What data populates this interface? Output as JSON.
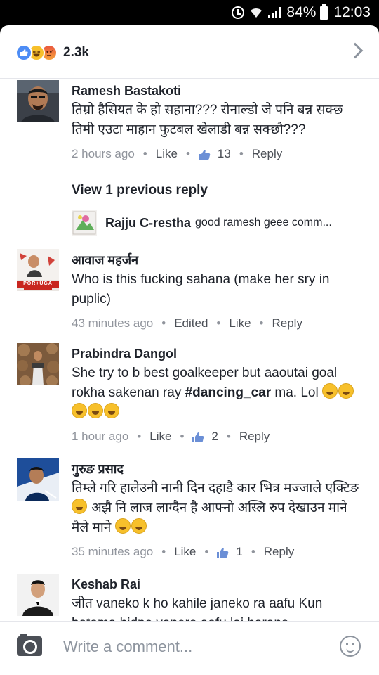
{
  "status_bar": {
    "battery": "84%",
    "time": "12:03"
  },
  "reactions": {
    "icons": [
      "like-icon",
      "haha-icon",
      "angry-icon"
    ],
    "count": "2.3k"
  },
  "comments": [
    {
      "author": "Ramesh Bastakoti",
      "text": "तिम्रो हैसियत के हो सहाना??? रोनाल्डो जे पनि बन्न सक्छ तिमी एउटा माहान फुटबल खेलाडी बन्न सक्छौ???",
      "time": "2 hours ago",
      "like": "Like",
      "likes": "13",
      "reply": "Reply",
      "view_replies": "View 1 previous reply",
      "reply_preview": {
        "author": "Rajju C-restha",
        "text": "good ramesh geee comm..."
      }
    },
    {
      "author": "आवाज महर्जन",
      "text": "Who is this fucking sahana (make her sry in puplic)",
      "time": "43 minutes ago",
      "edited": "Edited",
      "like": "Like",
      "reply": "Reply",
      "avatar_banner": "POR+UGA"
    },
    {
      "author": "Prabindra Dangol",
      "text_before": "She try to b best goalkeeper but aaoutai goal rokha sakenan ray ",
      "hashtag": "#dancing_car",
      "text_after": " ma. Lol",
      "time": "1 hour ago",
      "like": "Like",
      "likes": "2",
      "reply": "Reply"
    },
    {
      "author": "गुरुङ प्रसाद",
      "text_before": "तिम्ले गरि हालेउनी नानी दिन दहाडै कार भित्र मज्जाले एक्टिङ ",
      "text_mid": " अझै नि लाज लाग्दैन है आफ्नो अस्लि रुप देखाउन माने मैले माने ",
      "time": "35 minutes ago",
      "like": "Like",
      "likes": "1",
      "reply": "Reply"
    },
    {
      "author": "Keshab Rai",
      "text": "जीत vaneko k ho kahile janeko ra aafu Kun hatama hidne vanera aafu lai harana"
    }
  ],
  "composer": {
    "placeholder": "Write a comment..."
  },
  "colors": {
    "like_blue": "#4d8cf5",
    "meta_gray": "#90949c",
    "text_dark": "#1d2129"
  }
}
